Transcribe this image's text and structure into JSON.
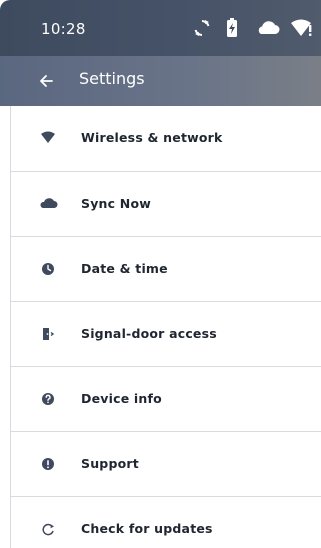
{
  "status_bar": {
    "time": "10:28",
    "icons": [
      "sync-icon",
      "battery-charging-icon",
      "cloud-icon",
      "wifi-alert-icon"
    ]
  },
  "app_bar": {
    "back_icon": "arrow-left-icon",
    "title": "Settings"
  },
  "colors": {
    "status_bar": "#3e4a5e",
    "app_bar": "#5a6780",
    "icon": "#3f4a5c",
    "text": "#1f2630",
    "divider": "#d8dbe0"
  },
  "menu": {
    "items": [
      {
        "label": "Wireless & network",
        "icon": "wifi-icon"
      },
      {
        "label": "Sync Now",
        "icon": "cloud-icon"
      },
      {
        "label": "Date & time",
        "icon": "clock-icon"
      },
      {
        "label": "Signal-door access",
        "icon": "door-icon"
      },
      {
        "label": "Device info",
        "icon": "help-icon"
      },
      {
        "label": "Support",
        "icon": "alert-icon"
      },
      {
        "label": "Check for updates",
        "icon": "refresh-icon"
      }
    ]
  }
}
